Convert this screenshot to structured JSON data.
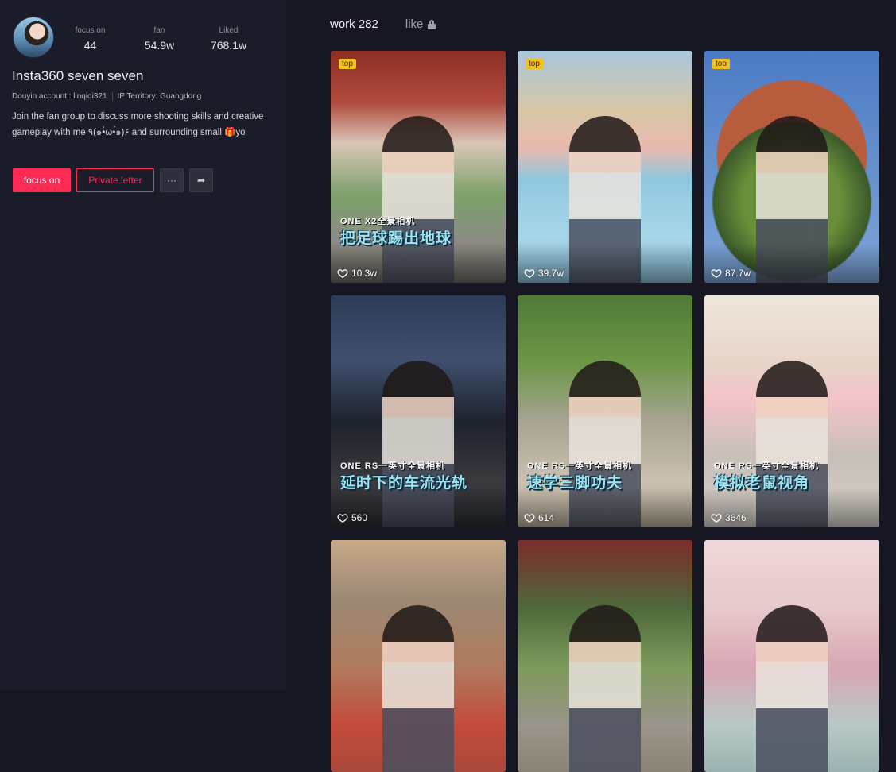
{
  "profile": {
    "stats": [
      {
        "label": "focus on",
        "value": "44"
      },
      {
        "label": "fan",
        "value": "54.9w"
      },
      {
        "label": "Liked",
        "value": "768.1w"
      }
    ],
    "name": "Insta360 seven seven",
    "account": "Douyin account : linqiqi321",
    "ip": "IP Territory: Guangdong",
    "bio": "Join the fan group to discuss more shooting skills and creative gameplay with me ٩(๑•̀ω•́๑)۶ and surrounding small 🎁yo",
    "buttons": {
      "focus": "focus on",
      "letter": "Private letter",
      "more": "···",
      "share": "➦"
    }
  },
  "tabs": {
    "works": "work 282",
    "like": "like"
  },
  "works": [
    {
      "badge": "top",
      "cap1": "ONE X2全景相机",
      "cap2": "把足球踢出地球",
      "likes": "10.3w"
    },
    {
      "badge": "top",
      "cap1": "",
      "cap2": "",
      "likes": "39.7w"
    },
    {
      "badge": "top",
      "cap1": "",
      "cap2": "",
      "likes": "87.7w"
    },
    {
      "badge": "",
      "cap1": "ONE RS一英寸全景相机",
      "cap2": "延时下的车流光轨",
      "likes": "560"
    },
    {
      "badge": "",
      "cap1": "ONE RS一英寸全景相机",
      "cap2": "速学三脚功夫",
      "likes": "614"
    },
    {
      "badge": "",
      "cap1": "ONE RS一英寸全景相机",
      "cap2": "模拟老鼠视角",
      "likes": "3646"
    },
    {
      "badge": "",
      "cap1": "",
      "cap2": "",
      "likes": ""
    },
    {
      "badge": "",
      "cap1": "",
      "cap2": "",
      "likes": ""
    },
    {
      "badge": "",
      "cap1": "",
      "cap2": "",
      "likes": ""
    }
  ],
  "colors": {
    "accent": "#fe2c55",
    "badge": "#f5c21b",
    "background": "#161722",
    "sidebar": "#1b1c29"
  }
}
